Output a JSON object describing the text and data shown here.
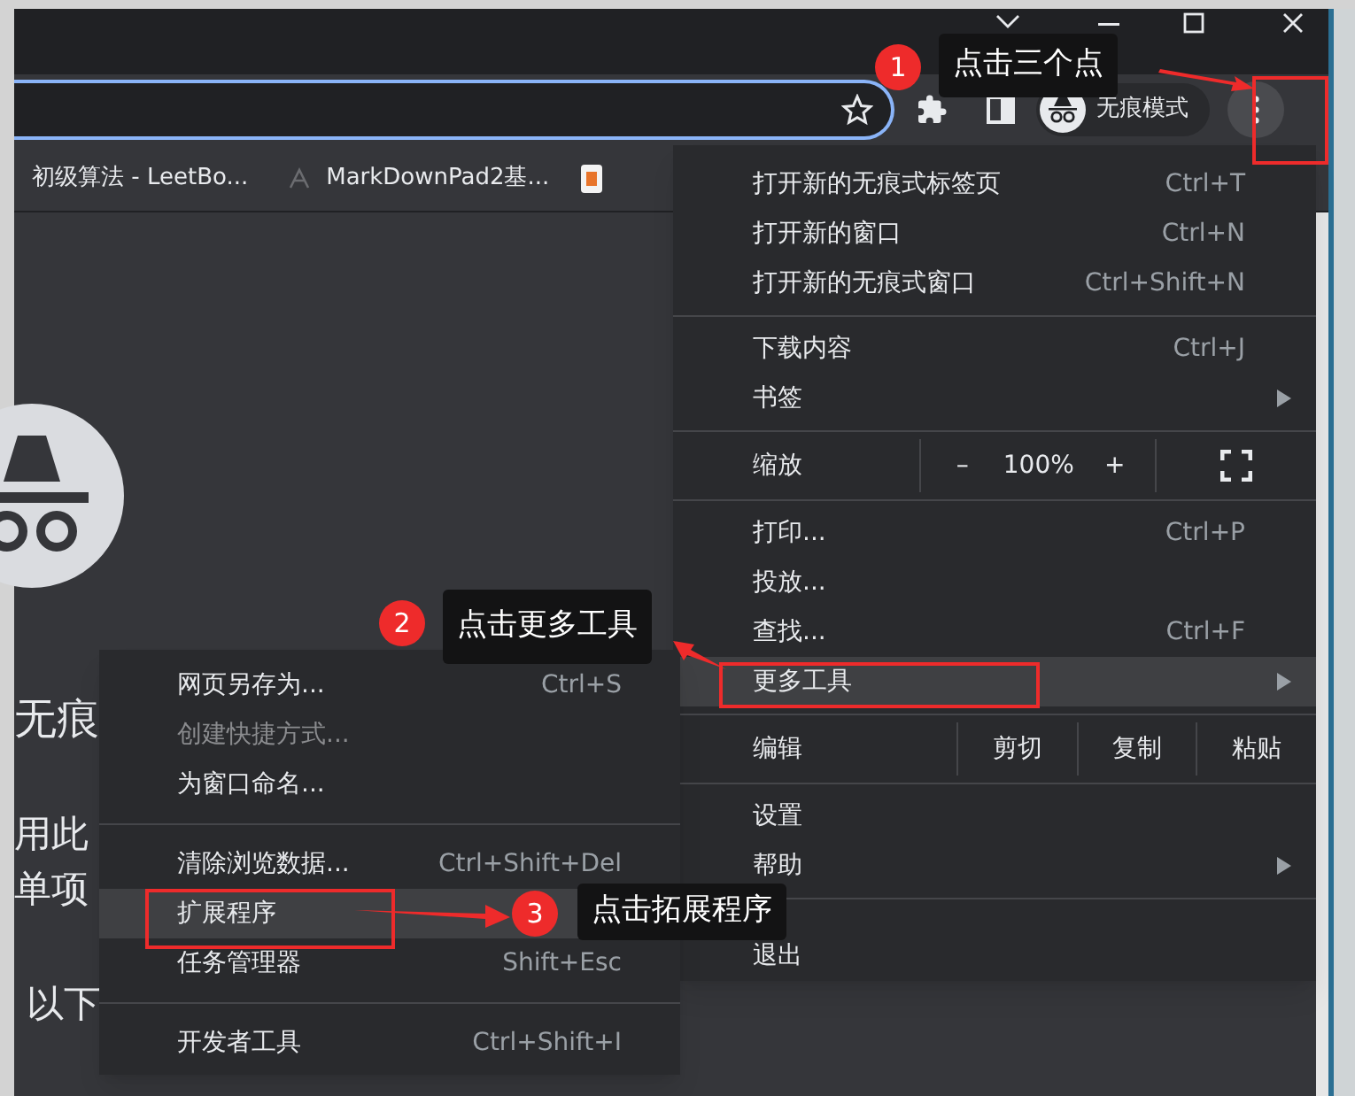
{
  "toolbar": {
    "profile_label": "无痕模式"
  },
  "bookmarks": [
    {
      "label": "初级算法 - LeetBo..."
    },
    {
      "label": "MarkDownPad2基..."
    }
  ],
  "page": {
    "heading": "无痕",
    "lines": [
      "用此",
      "单项"
    ],
    "footer": "以下"
  },
  "menu": {
    "items": [
      {
        "kind": "item",
        "label": "打开新的无痕式标签页",
        "shortcut": "Ctrl+T",
        "submenu": false,
        "highlighted": false,
        "disabled": false
      },
      {
        "kind": "item",
        "label": "打开新的窗口",
        "shortcut": "Ctrl+N",
        "submenu": false,
        "highlighted": false,
        "disabled": false
      },
      {
        "kind": "item",
        "label": "打开新的无痕式窗口",
        "shortcut": "Ctrl+Shift+N",
        "submenu": false,
        "highlighted": false,
        "disabled": false
      },
      {
        "kind": "separator"
      },
      {
        "kind": "item",
        "label": "下载内容",
        "shortcut": "Ctrl+J",
        "submenu": false,
        "highlighted": false,
        "disabled": false
      },
      {
        "kind": "item",
        "label": "书签",
        "submenu": true,
        "highlighted": false,
        "disabled": false
      },
      {
        "kind": "separator"
      },
      {
        "kind": "zoom",
        "label": "缩放",
        "minus": "–",
        "value": "100%",
        "plus": "+"
      },
      {
        "kind": "separator"
      },
      {
        "kind": "item",
        "label": "打印...",
        "shortcut": "Ctrl+P",
        "submenu": false,
        "highlighted": false,
        "disabled": false
      },
      {
        "kind": "item",
        "label": "投放...",
        "submenu": false,
        "highlighted": false,
        "disabled": false
      },
      {
        "kind": "item",
        "label": "查找...",
        "shortcut": "Ctrl+F",
        "submenu": false,
        "highlighted": false,
        "disabled": false
      },
      {
        "kind": "item",
        "label": "更多工具",
        "submenu": true,
        "highlighted": true,
        "disabled": false
      },
      {
        "kind": "separator"
      },
      {
        "kind": "edit",
        "label": "编辑",
        "actions": [
          "剪切",
          "复制",
          "粘贴"
        ]
      },
      {
        "kind": "separator"
      },
      {
        "kind": "item",
        "label": "设置",
        "submenu": false,
        "highlighted": false,
        "disabled": false
      },
      {
        "kind": "item",
        "label": "帮助",
        "submenu": true,
        "highlighted": false,
        "disabled": false
      },
      {
        "kind": "separator"
      },
      {
        "kind": "item",
        "label": "退出",
        "submenu": false,
        "highlighted": false,
        "disabled": false
      }
    ]
  },
  "submenu": {
    "items": [
      {
        "kind": "item",
        "label": "网页另存为...",
        "shortcut": "Ctrl+S",
        "submenu": false,
        "highlighted": false,
        "disabled": false
      },
      {
        "kind": "item",
        "label": "创建快捷方式...",
        "submenu": false,
        "highlighted": false,
        "disabled": true
      },
      {
        "kind": "item",
        "label": "为窗口命名...",
        "submenu": false,
        "highlighted": false,
        "disabled": false
      },
      {
        "kind": "separator"
      },
      {
        "kind": "item",
        "label": "清除浏览数据...",
        "shortcut": "Ctrl+Shift+Del",
        "submenu": false,
        "highlighted": false,
        "disabled": false
      },
      {
        "kind": "item",
        "label": "扩展程序",
        "submenu": false,
        "highlighted": true,
        "disabled": false
      },
      {
        "kind": "item",
        "label": "任务管理器",
        "shortcut": "Shift+Esc",
        "submenu": false,
        "highlighted": false,
        "disabled": false
      },
      {
        "kind": "separator"
      },
      {
        "kind": "item",
        "label": "开发者工具",
        "shortcut": "Ctrl+Shift+I",
        "submenu": false,
        "highlighted": false,
        "disabled": false
      }
    ]
  },
  "annotations": [
    {
      "number": "1",
      "text": "点击三个点"
    },
    {
      "number": "2",
      "text": "点击更多工具"
    },
    {
      "number": "3",
      "text": "点击拓展程序"
    }
  ]
}
